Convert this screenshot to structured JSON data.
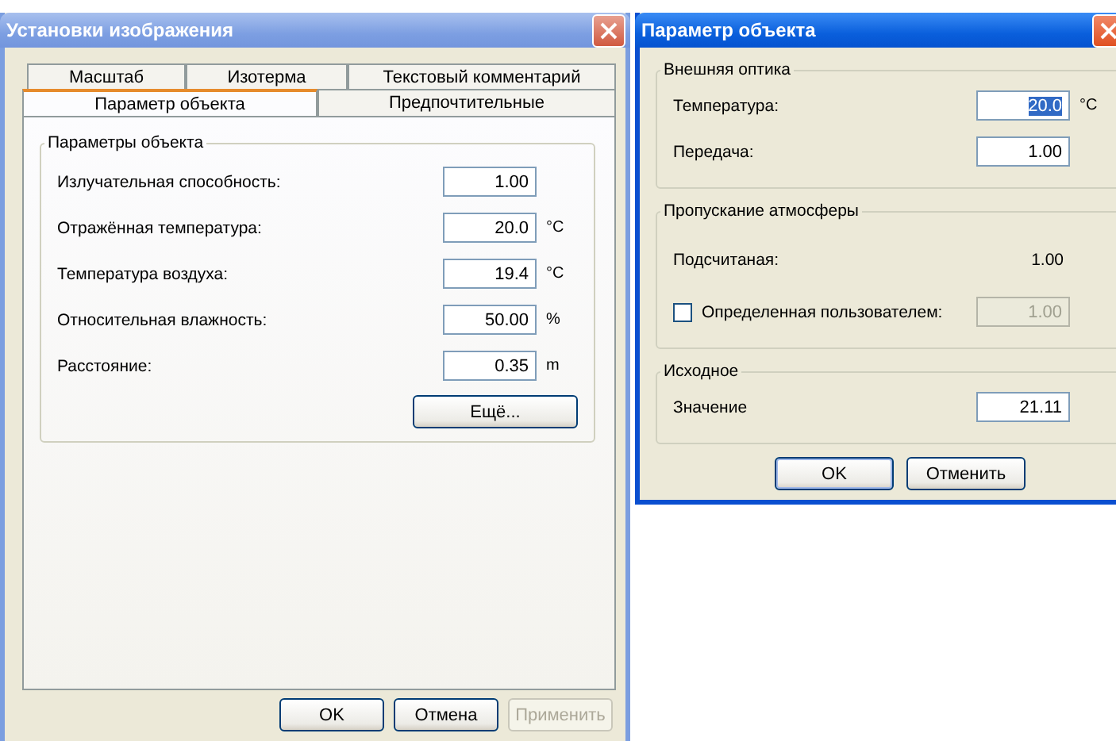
{
  "settings_window": {
    "title": "Установки изображения",
    "tabs_row_1": [
      {
        "label": "Масштаб",
        "selected": false
      },
      {
        "label": "Изотерма",
        "selected": false
      },
      {
        "label": "Текстовый комментарий",
        "selected": false
      }
    ],
    "tabs_row_2": [
      {
        "label": "Параметр объекта",
        "selected": true
      },
      {
        "label": "Предпочтительные",
        "selected": false
      }
    ],
    "group": {
      "title": "Параметры объекта",
      "fields": [
        {
          "label": "Излучательная способность:",
          "value": "1.00"
        },
        {
          "label": "Отражённая температура:",
          "value": "20.0",
          "unit": "°C"
        },
        {
          "label": "Температура воздуха:",
          "value": "19.4",
          "unit": "°C"
        },
        {
          "label": "Относительная  влажность:",
          "value": "50.00",
          "unit": "%"
        },
        {
          "label": "Расстояние:",
          "value": "0.35",
          "unit": "m"
        }
      ]
    },
    "more_button": "Ещё...",
    "buttons": [
      {
        "label": "OK",
        "disabled": false
      },
      {
        "label": "Отмена",
        "disabled": false
      },
      {
        "label": "Применить",
        "disabled": true
      }
    ]
  },
  "object_dialog": {
    "title": "Параметр объекта",
    "optics": {
      "title": "Внешняя оптика",
      "fields": [
        {
          "label": "Температура:",
          "value": "20.0",
          "unit": "°C",
          "selected": true
        },
        {
          "label": "Передача:",
          "value": "1.00",
          "selected": false
        }
      ]
    },
    "atmosphere": {
      "title": "Пропускание атмосферы",
      "calculated": {
        "label": "Подсчитаная:",
        "value": "1.00"
      },
      "user_defined": {
        "label": "Определенная пользователем:",
        "checked": false,
        "value": "1.00",
        "disabled": true
      }
    },
    "source": {
      "title": "Исходное",
      "fields": [
        {
          "label": "Значение",
          "value": "21.11",
          "selected": false
        }
      ]
    },
    "buttons": [
      {
        "label": "OK",
        "default": true
      },
      {
        "label": "Отменить",
        "default": false
      }
    ]
  }
}
